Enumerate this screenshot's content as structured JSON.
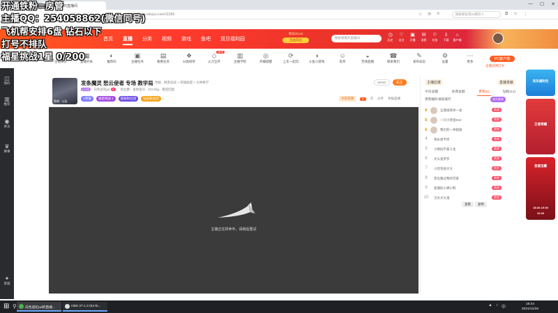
{
  "browser": {
    "tab_title": "白色恶犯PD的直播间",
    "url": "https://www.douyu.com/11569",
    "search_placeholder": "搜索新标签15网页人",
    "window_controls": [
      "—",
      "☐",
      "✕"
    ]
  },
  "overlay": {
    "line1": "开通铁粉=房管",
    "line2": "主播QQ：254058862(微信同号)",
    "line3": "飞机帮安排6盘 钻石以下",
    "line4": "打号不排队",
    "line5": "福星挑战1星 0/200"
  },
  "site_header": {
    "logo": "斗鱼",
    "nav": [
      "首页",
      "直播",
      "分类",
      "视频",
      "游戏",
      "鱼吧",
      "双旦福利园"
    ],
    "promo_date": "每日20:24",
    "promo_btn": "全站开启",
    "search_placeholder": "搜索想看的直播间",
    "icons": [
      {
        "name": "history",
        "glyph": "◷",
        "label": "历史"
      },
      {
        "name": "follow",
        "glyph": "♡",
        "label": "关注"
      },
      {
        "name": "open",
        "glyph": "▣",
        "label": "开播"
      },
      {
        "name": "message",
        "glyph": "✉",
        "label": "消息"
      },
      {
        "name": "task",
        "glyph": "⚐",
        "label": "任务"
      },
      {
        "name": "download",
        "glyph": "⇩",
        "label": "下载"
      },
      {
        "name": "client",
        "glyph": "⌂",
        "label": "客户端"
      }
    ]
  },
  "left_bar": [
    {
      "icon": "◫",
      "label": "我的"
    },
    {
      "icon": "▥",
      "label": "推荐"
    },
    {
      "icon": "◉",
      "label": "关注"
    },
    {
      "icon": "♛",
      "label": "赛事"
    },
    {
      "icon": "✦",
      "label": "客服"
    }
  ],
  "categories": [
    {
      "glyph": "◈",
      "label": "主播积分"
    },
    {
      "glyph": "▦",
      "label": "直播开关"
    },
    {
      "glyph": "◐",
      "label": "推荐码"
    },
    {
      "glyph": "▣",
      "label": "主播任务"
    },
    {
      "glyph": "▤",
      "label": "看看任务"
    },
    {
      "glyph": "❖",
      "label": "分类榜单"
    },
    {
      "glyph": "◇",
      "label": "火力全开",
      "badge": "NEW"
    },
    {
      "glyph": "▥",
      "label": "主播学院"
    },
    {
      "glyph": "◎",
      "label": "开播提醒"
    },
    {
      "glyph": "⟳",
      "label": "上车一起玩"
    },
    {
      "glyph": "◑",
      "label": "斗鱼小游戏"
    },
    {
      "glyph": "☺",
      "label": "友邦"
    },
    {
      "glyph": "◒",
      "label": "无线直播"
    },
    {
      "glyph": "☎",
      "label": "联系我们"
    },
    {
      "glyph": "✎",
      "label": "发布动态"
    },
    {
      "glyph": "⚙",
      "label": "设置"
    },
    {
      "glyph": "⋯",
      "label": "更多"
    }
  ],
  "pc_button": "PC客户端",
  "pc_sub": "主播说明口令",
  "room": {
    "title": "发条魔灵 愁云使者 专场 教学局",
    "tag": "举报 · 网游竞技 > 英雄联盟 > 大神教学",
    "level": "LV20",
    "nickname": "白色恶犯pd",
    "vip": "V",
    "meta": "· 粉丝数 · 查他鱼乐 · 203.8kg · 看后回复",
    "avatar_label": "鱼吧 · 公告",
    "badges": [
      "V荣誉",
      "福星挑战 1",
      "超级粉丝团",
      "钻石粉丝团"
    ],
    "follow_count": "38482",
    "follow_label": "关注",
    "today_label": "今日可领",
    "today_num": "1",
    "today_unit": "次",
    "share_label": "分享",
    "report_label": "举报直播"
  },
  "player": {
    "message": "主播正在拼命中，请稍后重试"
  },
  "right_panel": {
    "head_left": "主播应援",
    "head_right": "直播贡献",
    "tabs": [
      "今日总额",
      "本周总额",
      "贵宾(5)",
      "钻粉(12)"
    ],
    "active_tab": 2,
    "sub_title": "贵宾福利·榜前排行",
    "sub_btn": "成为贵宾",
    "rows": [
      {
        "rank": "♛",
        "name": "让我再等你一会",
        "tag": "贵宾"
      },
      {
        "rank": "♛",
        "name": "一只小老鼠Dx2",
        "tag": "贵宾"
      },
      {
        "rank": "♛",
        "name": "我们的一并超级",
        "tag": "贵宾"
      },
      {
        "rank": "4",
        "name": "快乐星不听",
        "tag": "贵宾"
      },
      {
        "rank": "5",
        "name": "小明同学爱人生",
        "tag": "贵宾"
      },
      {
        "rank": "6",
        "name": "大头鬼罗罗",
        "tag": "贵宾"
      },
      {
        "rank": "7",
        "name": "小花花很大大",
        "tag": "贵宾"
      },
      {
        "rank": "8",
        "name": "黑化路过我的可爱",
        "tag": "贵宾"
      },
      {
        "rank": "9",
        "name": "星期的小棉小熊",
        "tag": "贵宾"
      },
      {
        "rank": "10",
        "name": "汉文大头鬼",
        "tag": "贵宾"
      }
    ],
    "popup": [
      "查看",
      "复制"
    ]
  },
  "right_rail": {
    "ad1": "欢乐福利包",
    "ad2": "王者荣耀",
    "ad3": "圣诞宝藏",
    "ad4": "18:30-19:00",
    "ad5": "19:30"
  },
  "taskbar": {
    "app1": "白色恶犯pd的直播...",
    "app2": "OBS 27.1.3 (64-bi...",
    "time": "18:34",
    "date": "2021/12/26"
  },
  "colors": {
    "brand": "#ff5d23",
    "header_gradient_start": "#ff5a1f",
    "header_gradient_end": "#d51e4a",
    "player_bg": "#3b3b3b",
    "taskbar": "#1f2023"
  }
}
